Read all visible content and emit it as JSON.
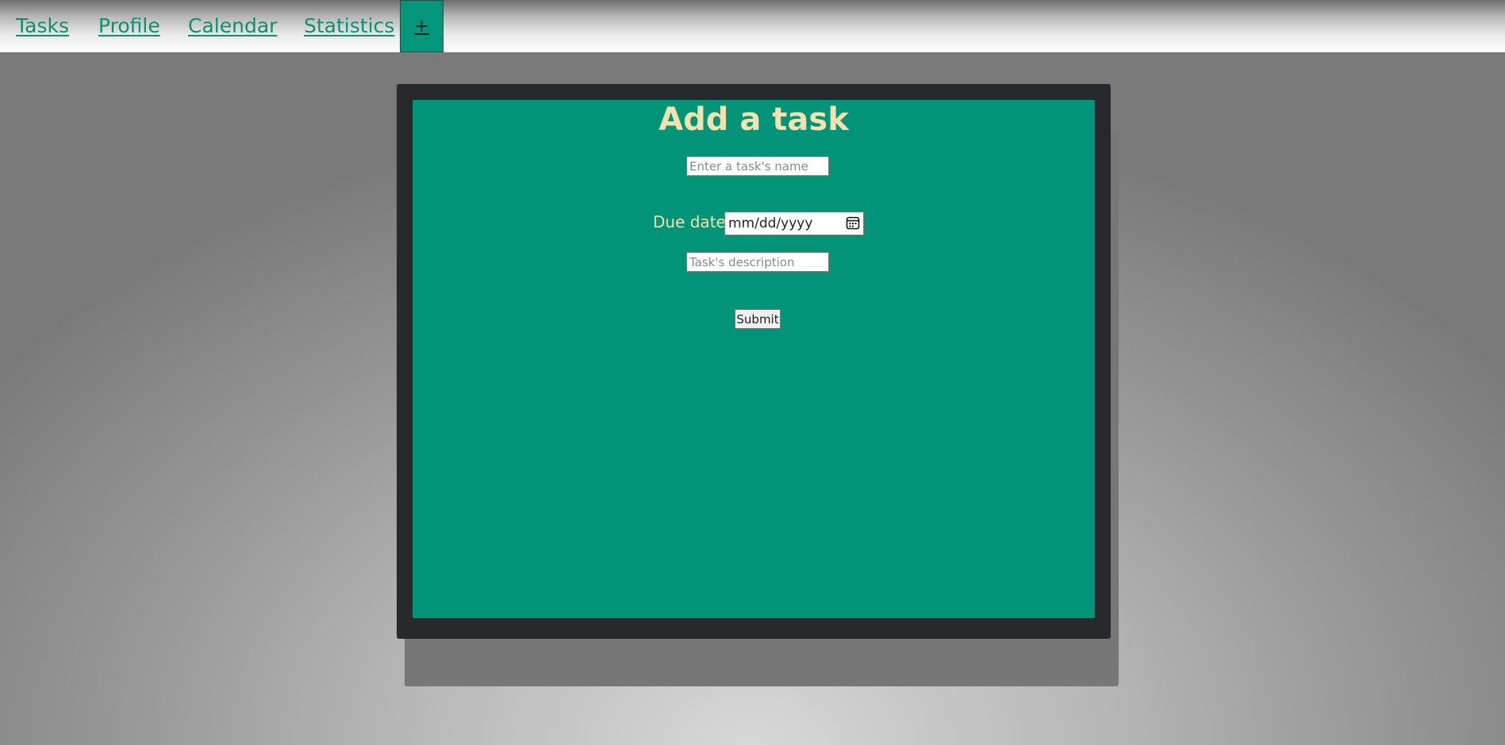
{
  "nav": {
    "items": [
      {
        "label": "Tasks"
      },
      {
        "label": "Profile"
      },
      {
        "label": "Calendar"
      },
      {
        "label": "Statistics"
      }
    ],
    "add_label": "+"
  },
  "form": {
    "title": "Add a task",
    "name_placeholder": "Enter a task's name",
    "due_date_label": "Due date",
    "due_date_placeholder": "mm/dd/yyyy",
    "description_placeholder": "Task's description",
    "submit_label": "Submit"
  },
  "colors": {
    "accent": "#029479",
    "frame": "#28292d",
    "title_text": "#f3e2ad",
    "nav_link": "#0f8f72"
  }
}
